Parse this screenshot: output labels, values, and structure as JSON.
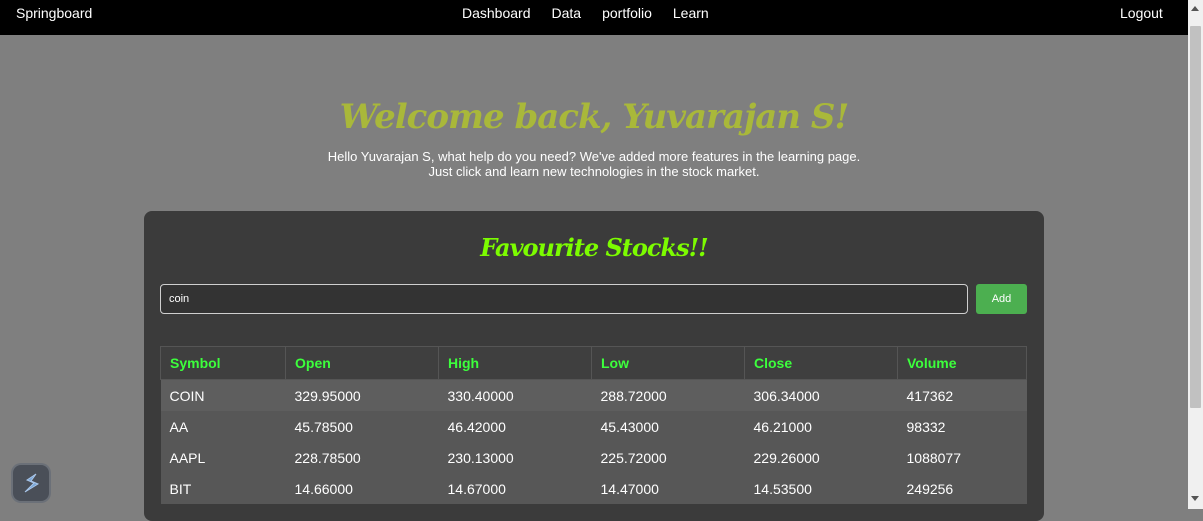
{
  "header": {
    "brand": "Springboard",
    "nav": [
      "Dashboard",
      "Data",
      "portfolio",
      "Learn"
    ],
    "logout": "Logout"
  },
  "hero": {
    "welcome": "Welcome back, Yuvarajan S!",
    "line1": "Hello Yuvarajan S, what help do you need? We've added more features in the learning page.",
    "line2": "Just click and learn new technologies in the stock market."
  },
  "favourites": {
    "title": "Favourite Stocks!!",
    "search_value": "coin",
    "add_label": "Add",
    "columns": [
      "Symbol",
      "Open",
      "High",
      "Low",
      "Close",
      "Volume"
    ],
    "rows": [
      [
        "COIN",
        "329.95000",
        "330.40000",
        "288.72000",
        "306.34000",
        "417362"
      ],
      [
        "AA",
        "45.78500",
        "46.42000",
        "45.43000",
        "46.21000",
        "98332"
      ],
      [
        "AAPL",
        "228.78500",
        "230.13000",
        "225.72000",
        "229.26000",
        "1088077"
      ],
      [
        "BIT",
        "14.66000",
        "14.67000",
        "14.47000",
        "14.53500",
        "249256"
      ]
    ]
  },
  "colors": {
    "welcome": "#a9b83a",
    "title": "#7cfc00",
    "header_text": "#3cff3c",
    "add_button": "#4caf50"
  }
}
